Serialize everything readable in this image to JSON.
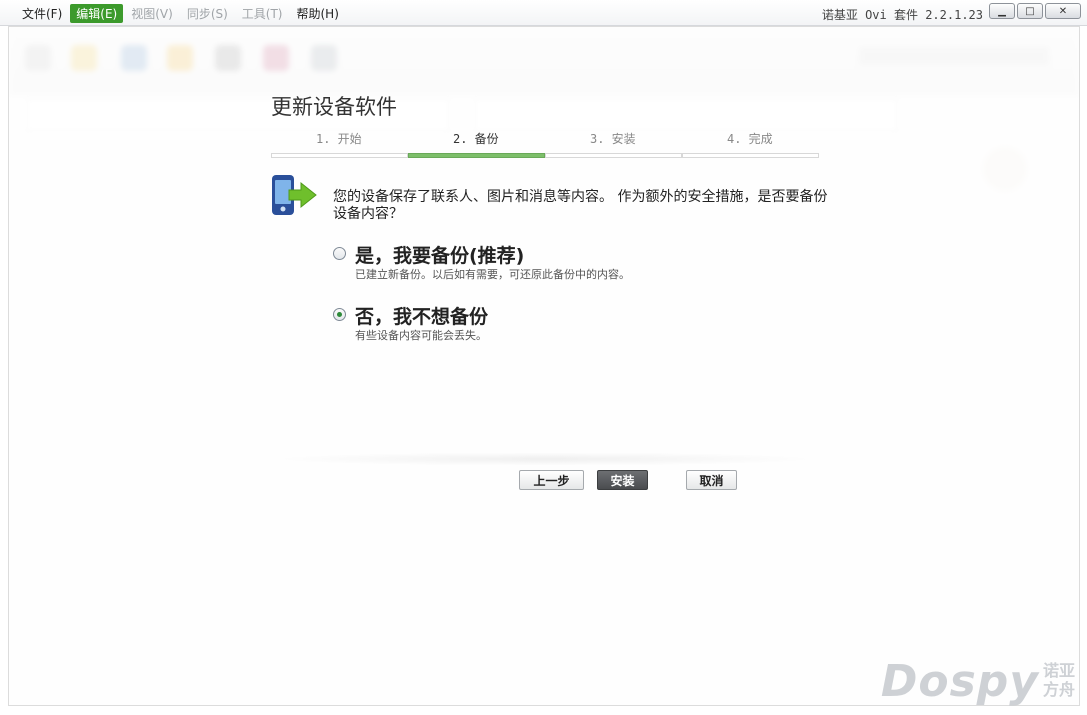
{
  "menu": {
    "items": [
      {
        "label": "文件(F)",
        "state": "normal"
      },
      {
        "label": "编辑(E)",
        "state": "active"
      },
      {
        "label": "视图(V)",
        "state": "disabled"
      },
      {
        "label": "同步(S)",
        "state": "disabled"
      },
      {
        "label": "工具(T)",
        "state": "disabled"
      },
      {
        "label": "帮助(H)",
        "state": "normal"
      }
    ]
  },
  "window": {
    "title": "诺基亚 Ovi 套件 2.2.1.23",
    "controls": {
      "minimize": "▁",
      "maximize": "□",
      "close": "✕"
    }
  },
  "dialog": {
    "title": "更新设备软件",
    "steps": [
      {
        "label": "1. 开始",
        "active": false
      },
      {
        "label": "2. 备份",
        "active": true
      },
      {
        "label": "3. 安装",
        "active": false
      },
      {
        "label": "4. 完成",
        "active": false
      }
    ],
    "icon": "phone-arrow-icon",
    "description": "您的设备保存了联系人、图片和消息等内容。 作为额外的安全措施，是否要备份设备内容？",
    "options": [
      {
        "title": "是，我要备份(推荐)",
        "subtitle": "已建立新备份。以后如有需要，可还原此备份中的内容。",
        "checked": false
      },
      {
        "title": "否，我不想备份",
        "subtitle": "有些设备内容可能会丢失。",
        "checked": true
      }
    ],
    "buttons": {
      "back": "上一步",
      "install": "安装",
      "cancel": "取消"
    }
  },
  "watermark": {
    "main": "Dospy",
    "side": "诺亚\n方舟"
  },
  "colors": {
    "accent_green": "#3c9a2c",
    "step_active": "#7dbf6a",
    "primary_button": "#4a4c4f"
  }
}
